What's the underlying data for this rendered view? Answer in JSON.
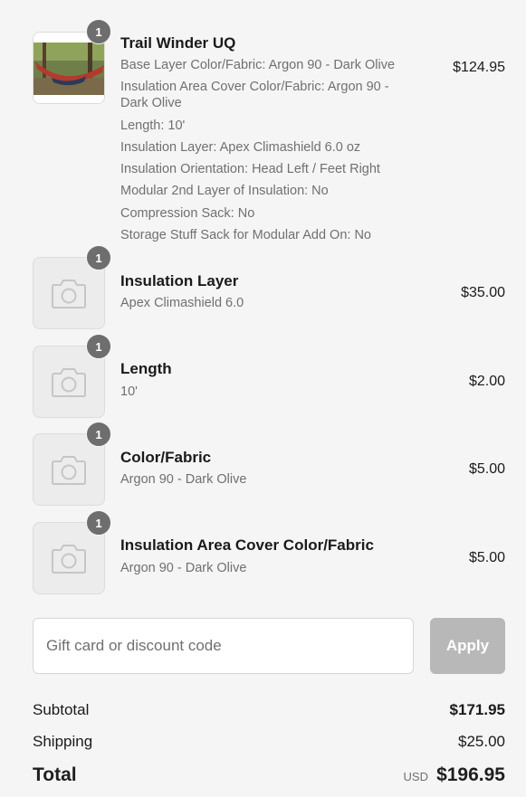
{
  "line_items": [
    {
      "quantity": "1",
      "title": "Trail Winder UQ",
      "price": "$124.95",
      "options": [
        "Base Layer Color/Fabric: Argon 90 - Dark Olive",
        "Insulation Area Cover Color/Fabric: Argon 90 -",
        "Dark Olive",
        "Length: 10'",
        "Insulation Layer: Apex Climashield 6.0 oz",
        "Insulation Orientation: Head Left / Feet Right",
        "Modular 2nd Layer of Insulation: No",
        "Compression Sack: No",
        "Storage Stuff Sack for Modular Add On: No"
      ]
    },
    {
      "quantity": "1",
      "title": "Insulation Layer",
      "subtitle": "Apex Climashield 6.0",
      "price": "$35.00"
    },
    {
      "quantity": "1",
      "title": "Length",
      "subtitle": "10'",
      "price": "$2.00"
    },
    {
      "quantity": "1",
      "title": "Color/Fabric",
      "subtitle": "Argon 90 - Dark Olive",
      "price": "$5.00"
    },
    {
      "quantity": "1",
      "title": "Insulation Area Cover Color/Fabric",
      "subtitle": "Argon 90 - Dark Olive",
      "price": "$5.00"
    }
  ],
  "discount": {
    "placeholder": "Gift card or discount code",
    "apply_label": "Apply"
  },
  "summary": {
    "subtotal_label": "Subtotal",
    "subtotal_value": "$171.95",
    "shipping_label": "Shipping",
    "shipping_value": "$25.00",
    "total_label": "Total",
    "currency": "USD",
    "total_value": "$196.95"
  },
  "icons": {
    "placeholder_thumbnail": "camera-icon",
    "product_photo": "hammock-photo"
  },
  "colors": {
    "badge": "#6e6e6e",
    "apply_button_disabled": "#b8b8b8",
    "muted_text": "#707070"
  }
}
